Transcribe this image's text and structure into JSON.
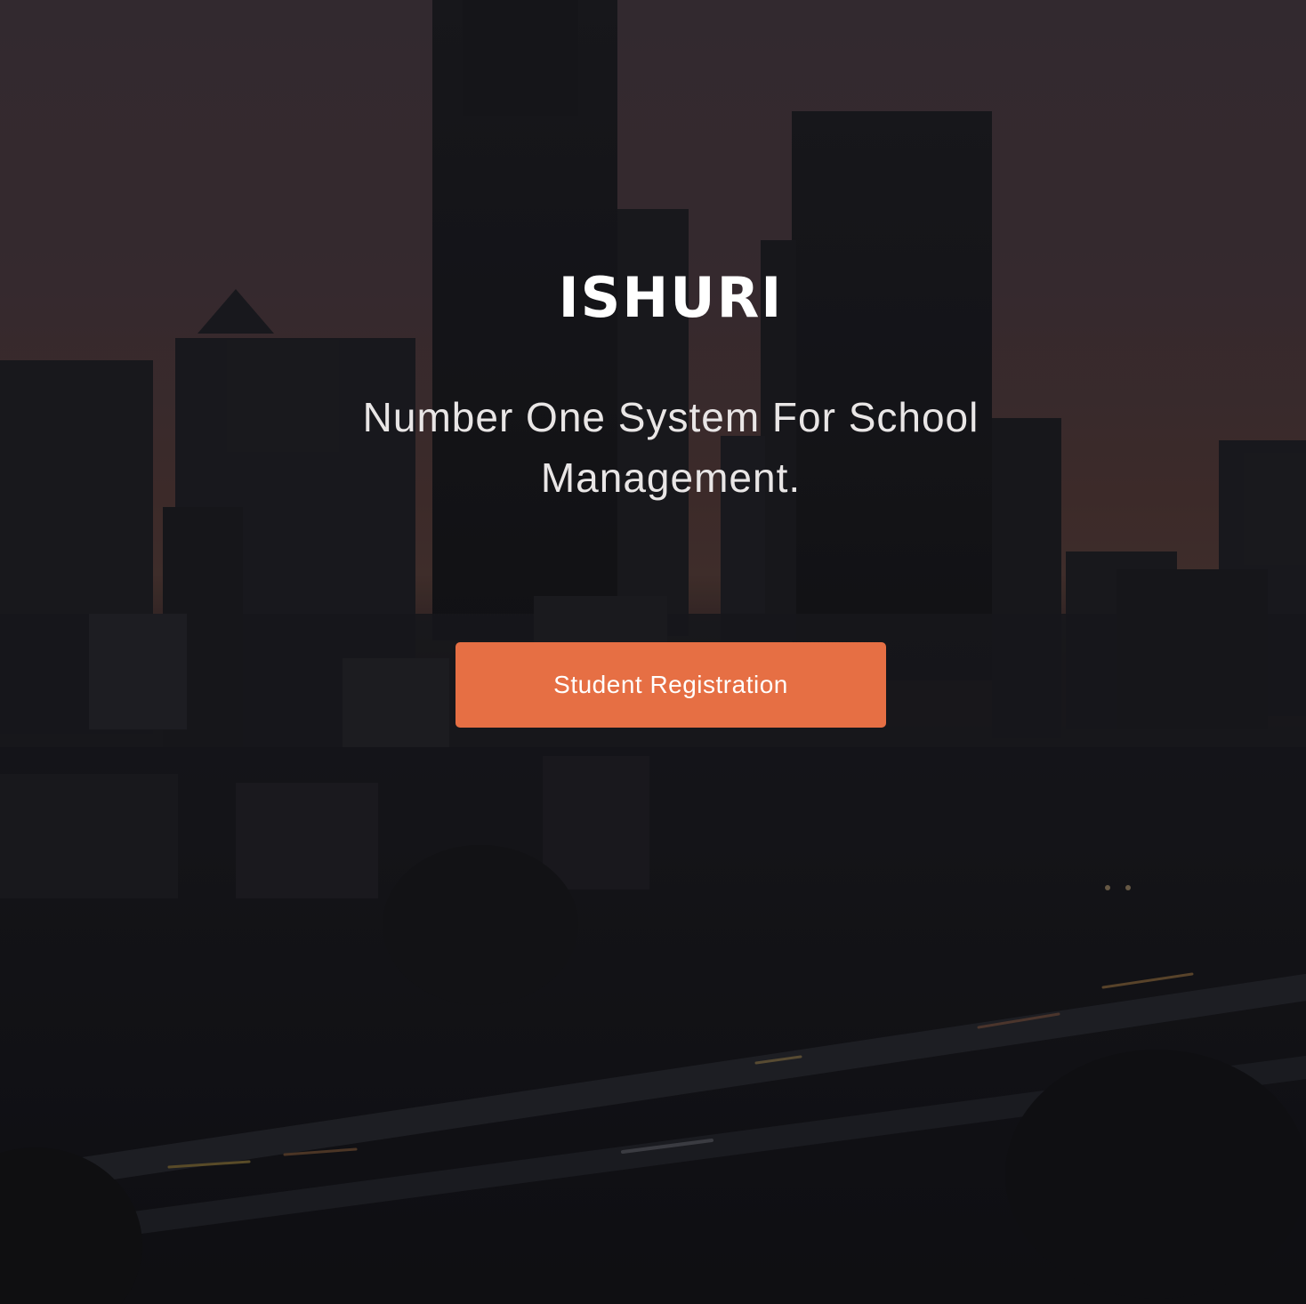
{
  "hero": {
    "brand": "ISHURI",
    "tagline_line1": "Number One System For School",
    "tagline_line2": "Management.",
    "register_button_label": "Student Registration"
  },
  "colors": {
    "button_background": "#e66f44",
    "text_primary": "#ffffff",
    "sky_top": "#3b3036",
    "sky_horizon": "#4a3530"
  }
}
